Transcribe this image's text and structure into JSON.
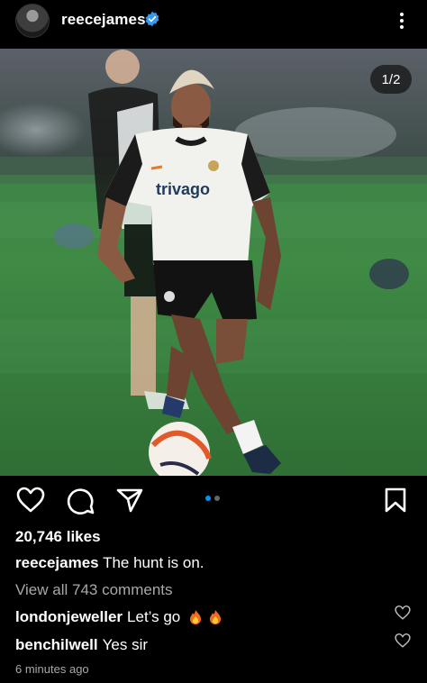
{
  "post": {
    "username": "reecejames",
    "more_icon": "more-vertical-icon",
    "image_counter": "1/2",
    "likes": "20,746 likes",
    "caption_user": "reecejames",
    "caption_text": "The hunt is on.",
    "view_comments": "View all 743 comments",
    "comments": [
      {
        "user": "londonjeweller",
        "text": "Let’s go",
        "emoji": [
          "fire",
          "fire"
        ]
      },
      {
        "user": "benchilwell",
        "text": "Yes sir"
      }
    ],
    "timestamp": "6 minutes ago",
    "shirt_text": "trivago"
  },
  "colors": {
    "accent": "#0095f6",
    "muted": "#a8a8a8"
  }
}
